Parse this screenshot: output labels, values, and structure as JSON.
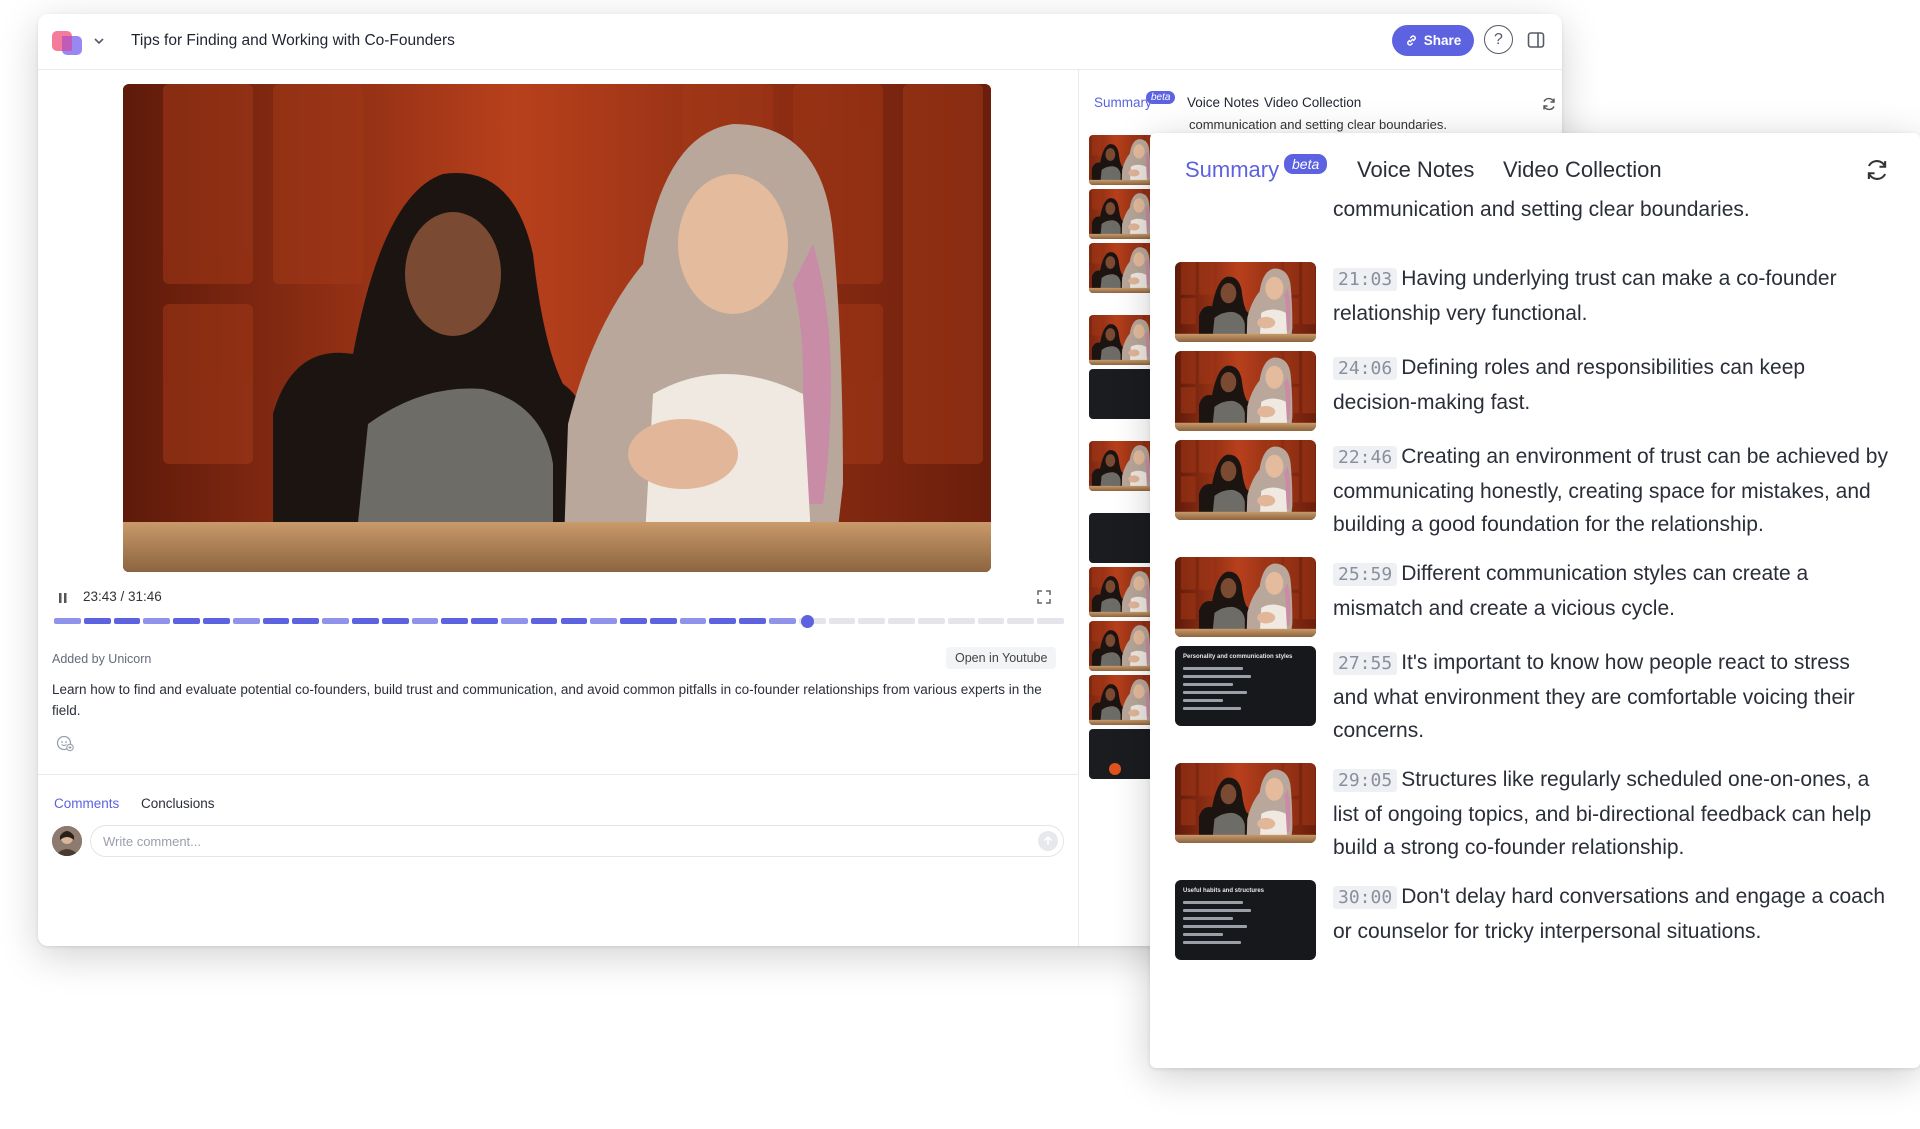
{
  "window": {
    "title": "Tips for Finding and Working with Co-Founders",
    "share_label": "Share",
    "help_label": "?"
  },
  "player": {
    "time": "23:43 / 31:46",
    "progress": 0.746
  },
  "meta": {
    "added_by": "Added by Unicorn",
    "open_youtube": "Open in Youtube",
    "description": "Learn how to find and evaluate potential co-founders, build trust and communication, and avoid common pitfalls in co-founder relationships from various experts in the field."
  },
  "comments": {
    "tabs": [
      "Comments",
      "Conclusions"
    ],
    "placeholder": "Write comment..."
  },
  "sidebar": {
    "tabs": [
      "Summary",
      "Voice Notes",
      "Video Collection"
    ],
    "beta": "beta",
    "cut_text": "communication and setting clear boundaries."
  },
  "summary": {
    "tabs": [
      "Summary",
      "Voice Notes",
      "Video Collection"
    ],
    "beta": "beta",
    "cut_text": "communication and setting clear boundaries.",
    "items": [
      {
        "time": "21:03",
        "text": "Having underlying trust can make a co-founder relationship very functional.",
        "thumb": "video"
      },
      {
        "time": "24:06",
        "text": "Defining roles and responsibilities can keep decision-making fast.",
        "thumb": "video"
      },
      {
        "time": "22:46",
        "text": "Creating an environment of trust can be achieved by communicating honestly, creating space for mistakes, and building a good foundation for the relationship.",
        "thumb": "video"
      },
      {
        "time": "25:59",
        "text": "Different communication styles can create a mismatch and create a vicious cycle.",
        "thumb": "video"
      },
      {
        "time": "27:55",
        "text": "It's important to know how people react to stress and what environment they are comfortable voicing their concerns.",
        "thumb": "slide",
        "slide_title": "Personality and communication styles"
      },
      {
        "time": "29:05",
        "text": "Structures like regularly scheduled one-on-ones, a list of ongoing topics, and bi-directional feedback can help build a strong co-founder relationship.",
        "thumb": "video"
      },
      {
        "time": "30:00",
        "text": "Don't delay hard conversations and engage a coach or counselor for tricky interpersonal situations.",
        "thumb": "slide",
        "slide_title": "Useful habits and structures"
      }
    ]
  },
  "colors": {
    "accent": "#5c62e0",
    "video_bg": "#8a2c12"
  }
}
